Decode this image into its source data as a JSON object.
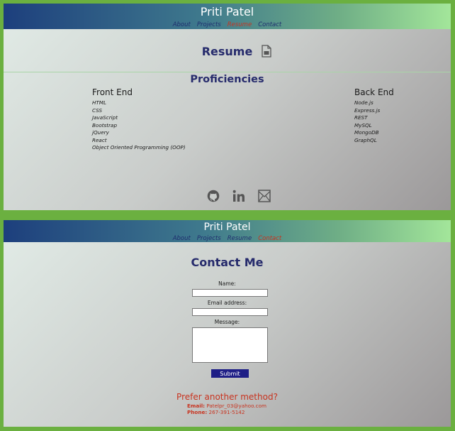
{
  "site_title": "Priti Patel",
  "nav": {
    "about": "About",
    "projects": "Projects",
    "resume": "Resume",
    "contact": "Contact"
  },
  "resume": {
    "heading": "Resume",
    "proficiencies_heading": "Proficiencies",
    "front_end": {
      "title": "Front End",
      "items": [
        "HTML",
        "CSS",
        "JavaScript",
        "Bootstrap",
        "jQuery",
        "React",
        "Object Oriented Programming (OOP)"
      ]
    },
    "back_end": {
      "title": "Back End",
      "items": [
        "Node.js",
        "Express.js",
        "REST",
        "MySQL",
        "MongoDB",
        "GraphQL"
      ]
    },
    "social_icons": [
      "github-icon",
      "linkedin-icon",
      "mail-icon"
    ]
  },
  "contact": {
    "heading": "Contact Me",
    "name_label": "Name:",
    "email_label": "Email address:",
    "message_label": "Message:",
    "submit_label": "Submit",
    "alt_heading": "Prefer another method?",
    "email_key": "Email:",
    "email_value": "Patelpr_03@yahoo.com",
    "phone_key": "Phone:",
    "phone_value": "267-391-5142"
  },
  "colors": {
    "accent_green": "#6bb040",
    "header_navy": "#1d3f7d",
    "heading_navy": "#262b6c",
    "active_red": "#c8331f",
    "submit_bg": "#1e1e86"
  }
}
